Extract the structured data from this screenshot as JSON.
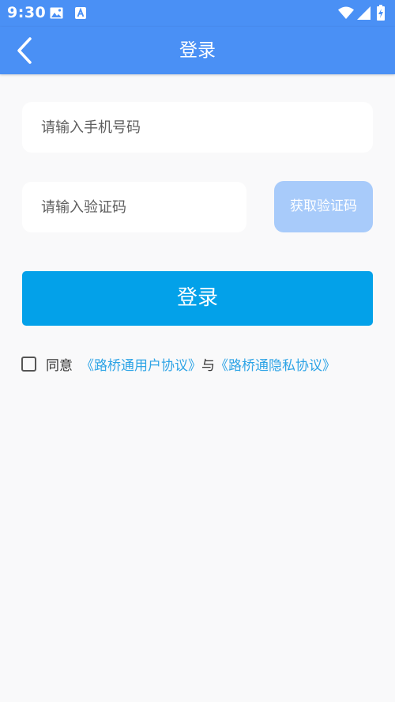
{
  "status_bar": {
    "time": "9:30"
  },
  "header": {
    "title": "登录"
  },
  "form": {
    "phone_placeholder": "请输入手机号码",
    "code_placeholder": "请输入验证码",
    "get_code_label": "获取验证码",
    "login_label": "登录"
  },
  "agreement": {
    "agree": "同意",
    "user_agreement": "《路桥通用户协议》",
    "joiner": "与",
    "privacy_agreement": "《路桥通隐私协议》"
  },
  "colors": {
    "header_bg": "#4a90f5",
    "login_button": "#03a1e9",
    "get_code_button": "#a8cbfa",
    "link": "#2ea4e6",
    "page_bg": "#f9f9fa"
  },
  "icons": {
    "status_left": [
      "image-icon",
      "a-letter-icon"
    ],
    "status_right": [
      "wifi-icon",
      "signal-icon",
      "battery-charging-icon"
    ],
    "back": "chevron-left-icon"
  }
}
